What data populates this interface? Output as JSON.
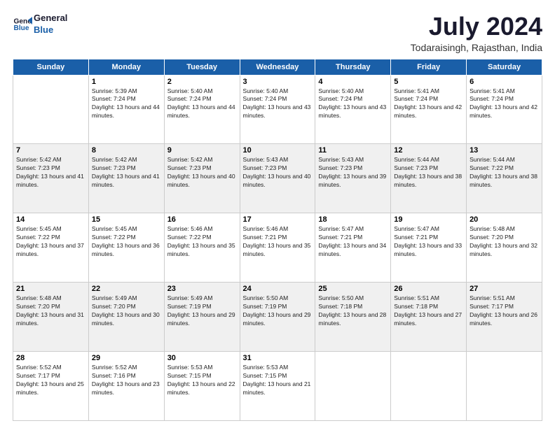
{
  "logo": {
    "line1": "General",
    "line2": "Blue"
  },
  "title": "July 2024",
  "subtitle": "Todaraisingh, Rajasthan, India",
  "weekdays": [
    "Sunday",
    "Monday",
    "Tuesday",
    "Wednesday",
    "Thursday",
    "Friday",
    "Saturday"
  ],
  "weeks": [
    [
      {
        "day": "",
        "sunrise": "",
        "sunset": "",
        "daylight": ""
      },
      {
        "day": "1",
        "sunrise": "5:39 AM",
        "sunset": "7:24 PM",
        "daylight": "13 hours and 44 minutes."
      },
      {
        "day": "2",
        "sunrise": "5:40 AM",
        "sunset": "7:24 PM",
        "daylight": "13 hours and 44 minutes."
      },
      {
        "day": "3",
        "sunrise": "5:40 AM",
        "sunset": "7:24 PM",
        "daylight": "13 hours and 43 minutes."
      },
      {
        "day": "4",
        "sunrise": "5:40 AM",
        "sunset": "7:24 PM",
        "daylight": "13 hours and 43 minutes."
      },
      {
        "day": "5",
        "sunrise": "5:41 AM",
        "sunset": "7:24 PM",
        "daylight": "13 hours and 42 minutes."
      },
      {
        "day": "6",
        "sunrise": "5:41 AM",
        "sunset": "7:24 PM",
        "daylight": "13 hours and 42 minutes."
      }
    ],
    [
      {
        "day": "7",
        "sunrise": "5:42 AM",
        "sunset": "7:23 PM",
        "daylight": "13 hours and 41 minutes."
      },
      {
        "day": "8",
        "sunrise": "5:42 AM",
        "sunset": "7:23 PM",
        "daylight": "13 hours and 41 minutes."
      },
      {
        "day": "9",
        "sunrise": "5:42 AM",
        "sunset": "7:23 PM",
        "daylight": "13 hours and 40 minutes."
      },
      {
        "day": "10",
        "sunrise": "5:43 AM",
        "sunset": "7:23 PM",
        "daylight": "13 hours and 40 minutes."
      },
      {
        "day": "11",
        "sunrise": "5:43 AM",
        "sunset": "7:23 PM",
        "daylight": "13 hours and 39 minutes."
      },
      {
        "day": "12",
        "sunrise": "5:44 AM",
        "sunset": "7:23 PM",
        "daylight": "13 hours and 38 minutes."
      },
      {
        "day": "13",
        "sunrise": "5:44 AM",
        "sunset": "7:22 PM",
        "daylight": "13 hours and 38 minutes."
      }
    ],
    [
      {
        "day": "14",
        "sunrise": "5:45 AM",
        "sunset": "7:22 PM",
        "daylight": "13 hours and 37 minutes."
      },
      {
        "day": "15",
        "sunrise": "5:45 AM",
        "sunset": "7:22 PM",
        "daylight": "13 hours and 36 minutes."
      },
      {
        "day": "16",
        "sunrise": "5:46 AM",
        "sunset": "7:22 PM",
        "daylight": "13 hours and 35 minutes."
      },
      {
        "day": "17",
        "sunrise": "5:46 AM",
        "sunset": "7:21 PM",
        "daylight": "13 hours and 35 minutes."
      },
      {
        "day": "18",
        "sunrise": "5:47 AM",
        "sunset": "7:21 PM",
        "daylight": "13 hours and 34 minutes."
      },
      {
        "day": "19",
        "sunrise": "5:47 AM",
        "sunset": "7:21 PM",
        "daylight": "13 hours and 33 minutes."
      },
      {
        "day": "20",
        "sunrise": "5:48 AM",
        "sunset": "7:20 PM",
        "daylight": "13 hours and 32 minutes."
      }
    ],
    [
      {
        "day": "21",
        "sunrise": "5:48 AM",
        "sunset": "7:20 PM",
        "daylight": "13 hours and 31 minutes."
      },
      {
        "day": "22",
        "sunrise": "5:49 AM",
        "sunset": "7:20 PM",
        "daylight": "13 hours and 30 minutes."
      },
      {
        "day": "23",
        "sunrise": "5:49 AM",
        "sunset": "7:19 PM",
        "daylight": "13 hours and 29 minutes."
      },
      {
        "day": "24",
        "sunrise": "5:50 AM",
        "sunset": "7:19 PM",
        "daylight": "13 hours and 29 minutes."
      },
      {
        "day": "25",
        "sunrise": "5:50 AM",
        "sunset": "7:18 PM",
        "daylight": "13 hours and 28 minutes."
      },
      {
        "day": "26",
        "sunrise": "5:51 AM",
        "sunset": "7:18 PM",
        "daylight": "13 hours and 27 minutes."
      },
      {
        "day": "27",
        "sunrise": "5:51 AM",
        "sunset": "7:17 PM",
        "daylight": "13 hours and 26 minutes."
      }
    ],
    [
      {
        "day": "28",
        "sunrise": "5:52 AM",
        "sunset": "7:17 PM",
        "daylight": "13 hours and 25 minutes."
      },
      {
        "day": "29",
        "sunrise": "5:52 AM",
        "sunset": "7:16 PM",
        "daylight": "13 hours and 23 minutes."
      },
      {
        "day": "30",
        "sunrise": "5:53 AM",
        "sunset": "7:15 PM",
        "daylight": "13 hours and 22 minutes."
      },
      {
        "day": "31",
        "sunrise": "5:53 AM",
        "sunset": "7:15 PM",
        "daylight": "13 hours and 21 minutes."
      },
      {
        "day": "",
        "sunrise": "",
        "sunset": "",
        "daylight": ""
      },
      {
        "day": "",
        "sunrise": "",
        "sunset": "",
        "daylight": ""
      },
      {
        "day": "",
        "sunrise": "",
        "sunset": "",
        "daylight": ""
      }
    ]
  ]
}
